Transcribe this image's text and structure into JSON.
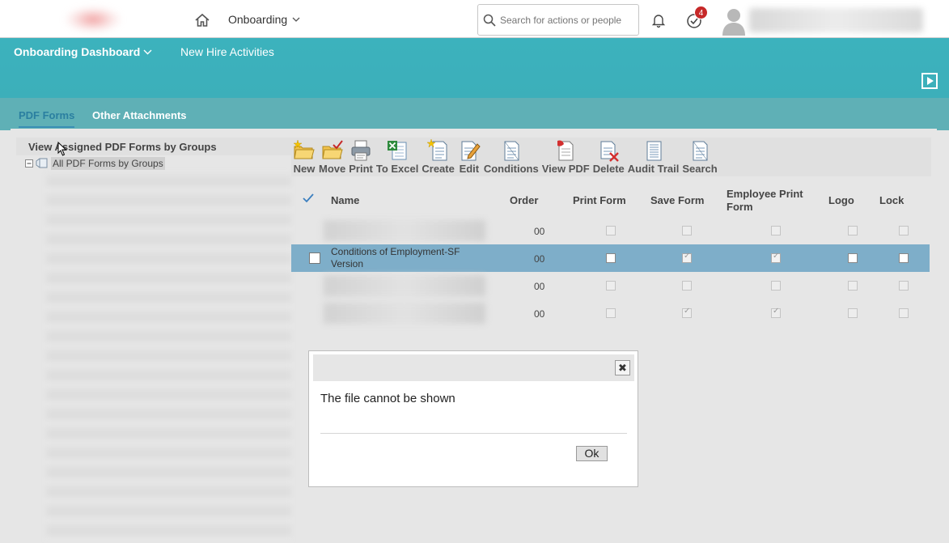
{
  "header": {
    "module_menu_label": "Onboarding",
    "search_placeholder": "Search for actions or people",
    "todo_count": "4"
  },
  "nav": {
    "dashboard_label": "Onboarding Dashboard",
    "new_hire_label": "New Hire Activities"
  },
  "tabs": [
    {
      "label": "PDF Forms",
      "active": true
    },
    {
      "label": "Other Attachments",
      "active": false
    }
  ],
  "tree": {
    "heading": "View Assigned PDF Forms by Groups",
    "root_label": "All PDF Forms by Groups"
  },
  "toolbar": {
    "buttons": [
      {
        "label": "New",
        "icon": "new-folder-icon"
      },
      {
        "label": "Move",
        "icon": "move-folder-icon"
      },
      {
        "label": "Print",
        "icon": "printer-icon"
      },
      {
        "label": "To Excel",
        "icon": "excel-icon"
      },
      {
        "label": "Create",
        "icon": "create-document-icon"
      },
      {
        "label": "Edit",
        "icon": "edit-document-icon"
      },
      {
        "label": "Conditions",
        "icon": "conditions-icon"
      },
      {
        "label": "View PDF",
        "icon": "pdf-icon"
      },
      {
        "label": "Delete",
        "icon": "delete-document-icon"
      },
      {
        "label": "Audit Trail",
        "icon": "audit-trail-icon"
      },
      {
        "label": "Search",
        "icon": "search-document-icon"
      }
    ]
  },
  "grid": {
    "columns": [
      "Name",
      "Order",
      "Print Form",
      "Save Form",
      "Employee Print Form",
      "Logo",
      "Lock"
    ],
    "rows": [
      {
        "name": "",
        "order": "00",
        "print_form": false,
        "save_form": false,
        "employee_print_form": false,
        "logo": false,
        "lock": false,
        "selected": false
      },
      {
        "name": "Conditions of Employment-SF Version",
        "order": "00",
        "print_form": false,
        "save_form": true,
        "employee_print_form": true,
        "logo": false,
        "lock": false,
        "selected": true
      },
      {
        "name": "",
        "order": "00",
        "print_form": false,
        "save_form": false,
        "employee_print_form": false,
        "logo": false,
        "lock": false,
        "selected": false
      },
      {
        "name": "",
        "order": "00",
        "print_form": false,
        "save_form": true,
        "employee_print_form": true,
        "logo": false,
        "lock": false,
        "selected": false
      }
    ]
  },
  "dialog": {
    "message": "The file cannot be shown",
    "ok_label": "Ok"
  },
  "colors": {
    "teal_nav": "#3cb2bd",
    "tab_band": "#5fb0b6",
    "selected_row": "#7eaec9",
    "badge": "#c62828"
  }
}
